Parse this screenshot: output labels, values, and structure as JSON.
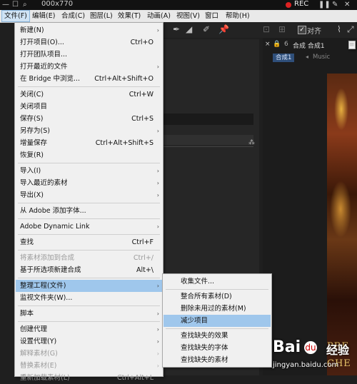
{
  "title_bar": {
    "title": "000x770",
    "recording_label": "REC"
  },
  "menubar": {
    "items": [
      {
        "label": "文件(F)"
      },
      {
        "label": "编辑(E)"
      },
      {
        "label": "合成(C)"
      },
      {
        "label": "图层(L)"
      },
      {
        "label": "效果(T)"
      },
      {
        "label": "动画(A)"
      },
      {
        "label": "视图(V)"
      },
      {
        "label": "窗口"
      },
      {
        "label": "帮助(H)"
      }
    ]
  },
  "toolbar": {
    "snap_label": "对齐"
  },
  "comp_panel": {
    "title": "合成 合成1",
    "active_tab": "合成1",
    "other_tab": "Music",
    "close_glyph": "×",
    "lock_glyph": "🔒",
    "num_glyph": "6",
    "menu_glyph": "≡"
  },
  "viewer": {
    "line1": "PRE",
    "line2": "CHE"
  },
  "watermark": {
    "brand": "Bai",
    "paw": "du",
    "sub": "经验",
    "url": "jingyan.baidu.com"
  },
  "file_menu": {
    "items": [
      {
        "label": "新建(N)",
        "shortcut": "",
        "arrow": "›"
      },
      {
        "label": "打开项目(O)...",
        "shortcut": "Ctrl+O",
        "arrow": ""
      },
      {
        "label": "打开团队项目...",
        "shortcut": "",
        "arrow": ""
      },
      {
        "label": "打开最近的文件",
        "shortcut": "",
        "arrow": "›"
      },
      {
        "label": "在 Bridge 中浏览...",
        "shortcut": "Ctrl+Alt+Shift+O",
        "arrow": ""
      },
      {
        "label": "关闭(C)",
        "shortcut": "Ctrl+W",
        "arrow": ""
      },
      {
        "label": "关闭项目",
        "shortcut": "",
        "arrow": ""
      },
      {
        "label": "保存(S)",
        "shortcut": "Ctrl+S",
        "arrow": ""
      },
      {
        "label": "另存为(S)",
        "shortcut": "",
        "arrow": "›"
      },
      {
        "label": "增量保存",
        "shortcut": "Ctrl+Alt+Shift+S",
        "arrow": ""
      },
      {
        "label": "恢复(R)",
        "shortcut": "",
        "arrow": ""
      },
      {
        "label": "导入(I)",
        "shortcut": "",
        "arrow": "›"
      },
      {
        "label": "导入最近的素材",
        "shortcut": "",
        "arrow": "›"
      },
      {
        "label": "导出(X)",
        "shortcut": "",
        "arrow": "›"
      },
      {
        "label": "从 Adobe 添加字体...",
        "shortcut": "",
        "arrow": ""
      },
      {
        "label": "Adobe Dynamic Link",
        "shortcut": "",
        "arrow": "›"
      },
      {
        "label": "查找",
        "shortcut": "Ctrl+F",
        "arrow": ""
      },
      {
        "label": "将素材添加到合成",
        "shortcut": "Ctrl+/",
        "arrow": ""
      },
      {
        "label": "基于所选项新建合成",
        "shortcut": "Alt+\\",
        "arrow": ""
      },
      {
        "label": "整理工程(文件)",
        "shortcut": "",
        "arrow": "›"
      },
      {
        "label": "监视文件夹(W)...",
        "shortcut": "",
        "arrow": ""
      },
      {
        "label": "脚本",
        "shortcut": "",
        "arrow": "›"
      },
      {
        "label": "创建代理",
        "shortcut": "",
        "arrow": "›"
      },
      {
        "label": "设置代理(Y)",
        "shortcut": "",
        "arrow": "›"
      },
      {
        "label": "解释素材(G)",
        "shortcut": "",
        "arrow": "›"
      },
      {
        "label": "替换素材(E)",
        "shortcut": "",
        "arrow": "›"
      },
      {
        "label": "重新加载素材(L)",
        "shortcut": "Ctrl+Alt+L",
        "arrow": ""
      }
    ]
  },
  "sub_menu": {
    "items": [
      {
        "label": "收集文件..."
      },
      {
        "label": "整合所有素材(D)"
      },
      {
        "label": "删除未用过的素材(M)"
      },
      {
        "label": "减少项目"
      },
      {
        "label": "查找缺失的效果"
      },
      {
        "label": "查找缺失的字体"
      },
      {
        "label": "查找缺失的素材"
      }
    ]
  }
}
